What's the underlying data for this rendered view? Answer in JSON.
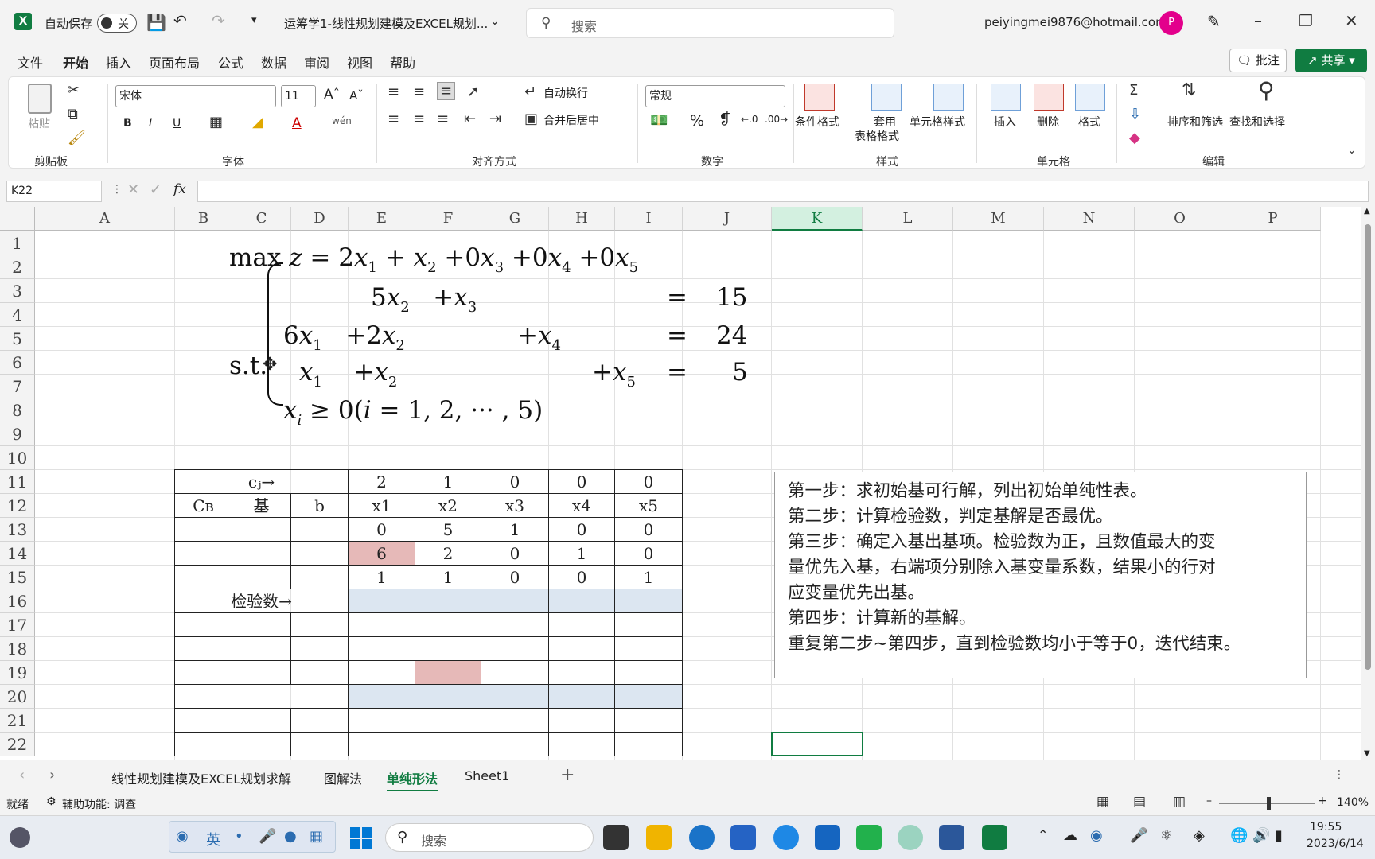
{
  "titlebar": {
    "autosave_label": "自动保存",
    "autosave_state": "关",
    "doc_title": "运筹学1-线性规划建模及EXCEL规划...",
    "search_placeholder": "搜索",
    "account": "peiyingmei9876@hotmail.com",
    "avatar_initial": "P"
  },
  "menu_tabs": [
    "文件",
    "开始",
    "插入",
    "页面布局",
    "公式",
    "数据",
    "审阅",
    "视图",
    "帮助"
  ],
  "comment_button": "批注",
  "share_button": "共享",
  "ribbon": {
    "clipboard": {
      "paste": "粘贴",
      "label": "剪贴板"
    },
    "font": {
      "name": "宋体",
      "size": "11",
      "label": "字体",
      "bold": "B",
      "italic": "I",
      "underline": "U"
    },
    "alignment": {
      "wrap": "自动换行",
      "merge": "合并后居中",
      "label": "对齐方式"
    },
    "number": {
      "format": "常规",
      "label": "数字",
      "percent": "%"
    },
    "styles": {
      "conditional": "条件格式",
      "table1": "套用",
      "table2": "表格格式",
      "cell_styles": "单元格样式",
      "label": "样式"
    },
    "cells": {
      "insert": "插入",
      "delete": "删除",
      "format": "格式",
      "label": "单元格"
    },
    "editing": {
      "sort": "排序和筛选",
      "find": "查找和选择",
      "label": "编辑"
    }
  },
  "formula_bar": {
    "name_box": "K22",
    "fx": "fx"
  },
  "columns": [
    "A",
    "B",
    "C",
    "D",
    "E",
    "F",
    "G",
    "H",
    "I",
    "J",
    "K",
    "L",
    "M",
    "N",
    "O",
    "P"
  ],
  "rows": [
    "1",
    "2",
    "3",
    "4",
    "5",
    "6",
    "7",
    "8",
    "9",
    "10",
    "11",
    "12",
    "13",
    "14",
    "15",
    "16",
    "17",
    "18",
    "19",
    "20",
    "21",
    "22"
  ],
  "model": {
    "objective": "max z = 2x1 + x2 +0x3 +0x4 +0x5",
    "st": "s.t.",
    "c1_rhs": "15",
    "c2_rhs": "24",
    "c3_rhs": "5",
    "eq": "=",
    "nonneg": "xi ≥ 0(i = 1, 2, ··· , 5)"
  },
  "table": {
    "cj_label": "cⱼ→",
    "cj": [
      "2",
      "1",
      "0",
      "0",
      "0"
    ],
    "headers": [
      "Cʙ",
      "基",
      "b",
      "x1",
      "x2",
      "x3",
      "x4",
      "x5"
    ],
    "rows": [
      [
        "0",
        "5",
        "1",
        "0",
        "0"
      ],
      [
        "6",
        "2",
        "0",
        "1",
        "0"
      ],
      [
        "1",
        "1",
        "0",
        "0",
        "1"
      ]
    ],
    "check_label": "检验数→"
  },
  "notes": [
    "第一步：求初始基可行解，列出初始单纯性表。",
    "第二步：计算检验数，判定基解是否最优。",
    "第三步：确定入基出基项。检验数为正，且数值最大的变",
    "量优先入基，右端项分别除入基变量系数，结果小的行对",
    "应变量优先出基。",
    "第四步：计算新的基解。",
    "重复第二步~第四步，直到检验数均小于等于0，迭代结束。"
  ],
  "sheet_tabs": [
    "线性规划建模及EXCEL规划求解",
    "图解法",
    "单纯形法",
    "Sheet1"
  ],
  "active_sheet": "单纯形法",
  "status": {
    "ready": "就绪",
    "accessibility": "辅助功能: 调查",
    "zoom": "140%"
  },
  "taskbar": {
    "search": "搜索",
    "ime": "英",
    "time": "19:55",
    "date": "2023/6/14"
  },
  "colors": {
    "accent": "#107c41",
    "pink_cell": "#e6b9b8",
    "blue_cell": "#dce6f1"
  }
}
